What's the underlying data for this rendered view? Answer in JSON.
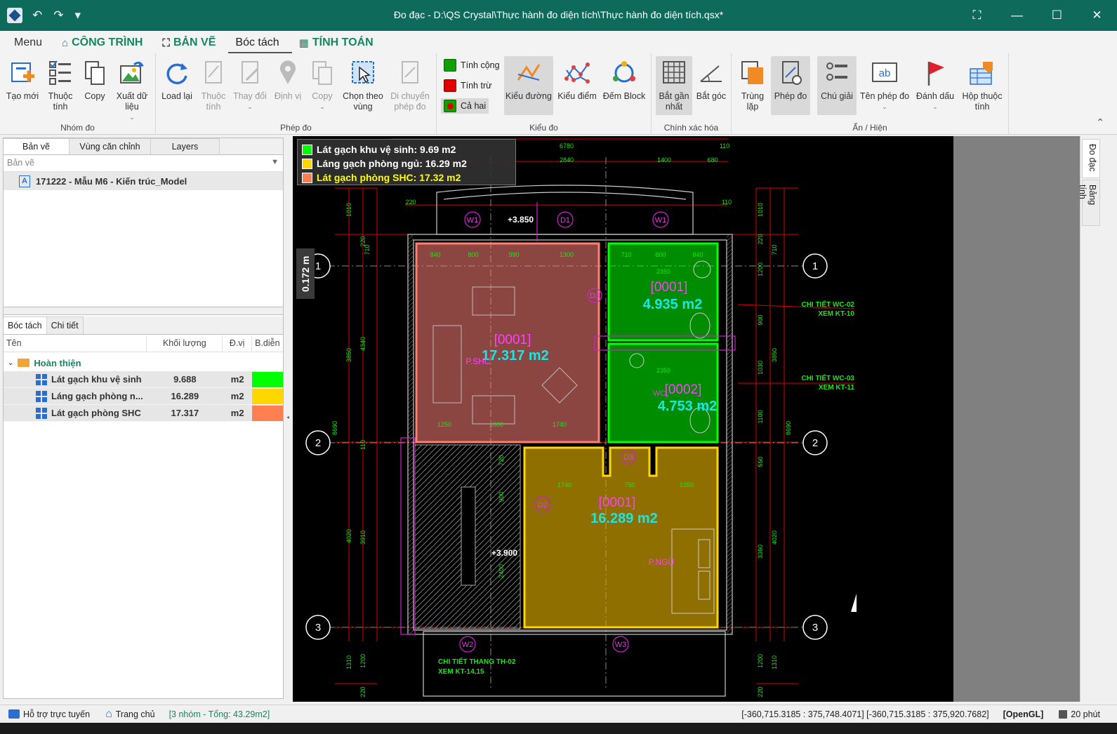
{
  "window": {
    "title": "Đo đạc - D:\\QS Crystal\\Thực hành đo diện tích\\Thực hành đo diện tích.qsx*",
    "quick_access": {
      "undo": "↶",
      "redo": "↷",
      "more": "▾"
    },
    "controls": {
      "restore": "⛶",
      "minimize": "—",
      "maximize": "☐",
      "close": "✕"
    }
  },
  "tabs": {
    "menu": "Menu",
    "cong_trinh": "CÔNG TRÌNH",
    "ban_ve": "BẢN VẼ",
    "boc_tach": "Bóc tách",
    "tinh_toan": "TÍNH TOÁN"
  },
  "ribbon": {
    "nhom_do": {
      "label": "Nhóm đo",
      "tao_moi": "Tạo mới",
      "thuoc_tinh": "Thuộc\ntính",
      "copy": "Copy",
      "xuat_du_lieu": "Xuất dữ\nliệu"
    },
    "phep_do": {
      "label": "Phép đo",
      "load_lai": "Load lại",
      "thuoc_tinh": "Thuộc\ntính",
      "thay_doi": "Thay đổi",
      "dinh_vi": "Định vị",
      "copy": "Copy",
      "chon_theo_vung": "Chọn theo\nvùng",
      "di_chuyen": "Di chuyển\nphép đo"
    },
    "kieu_do": {
      "label": "Kiểu đo",
      "tinh_cong": "Tính cộng",
      "tinh_tru": "Tính trừ",
      "ca_hai": "Cả hai",
      "kieu_duong": "Kiểu đường",
      "kieu_diem": "Kiểu điểm",
      "dem_block": "Đếm Block"
    },
    "chinh_xac_hoa": {
      "label": "Chính xác hóa",
      "bat_gan_nhat": "Bắt gần\nnhất",
      "bat_goc": "Bắt góc"
    },
    "an_hien": {
      "label": "Ẩn / Hiện",
      "trung_lap": "Trùng\nlặp",
      "phep_do": "Phép đo",
      "chu_giai": "Chú giải",
      "ten_phep_do": "Tên phép đo",
      "danh_dau": "Đánh dấu",
      "hop_thuoc_tinh": "Hộp thuộc\ntính"
    }
  },
  "left_panel": {
    "tabs": [
      "Bản vẽ",
      "Vùng căn chỉnh",
      "Layers"
    ],
    "filter_placeholder": "Bản vẽ",
    "drawing": "171222 - Mẫu M6 - Kiến trúc_Model",
    "drawing_icon": "A",
    "bottom_tabs": [
      "Bóc tách",
      "Chi tiết"
    ],
    "columns": [
      "Tên",
      "Khối lượng",
      "Đ.vị",
      "B.diễn"
    ],
    "group": "Hoàn thiện",
    "items": [
      {
        "name": "Lát gạch khu vệ sinh",
        "qty": "9.688",
        "unit": "m2",
        "color": "#00ff00"
      },
      {
        "name": "Láng gạch phòng n...",
        "qty": "16.289",
        "unit": "m2",
        "color": "#ffd700"
      },
      {
        "name": "Lát gạch phòng SHC",
        "qty": "17.317",
        "unit": "m2",
        "color": "#ff7f50"
      }
    ]
  },
  "canvas": {
    "legend": [
      {
        "text": "Lát gạch khu vệ sinh: 9.69 m2",
        "color": "#00ff00",
        "text_color": "#ffffff"
      },
      {
        "text": "Láng gạch phòng ngủ: 16.29 m2",
        "color": "#ffd700",
        "text_color": "#ffffff"
      },
      {
        "text": "Lát gạch phòng SHC: 17.32 m2",
        "color": "#ff7f50",
        "text_color": "#ffff00"
      }
    ],
    "scale_label": "0.172 m",
    "areas": {
      "shc_id": "[0001]",
      "shc_area": "17.317 m2",
      "shc_room": "P.SHC",
      "wc1_id": "[0001]",
      "wc1_area": "4.935 m2",
      "wc2_id": "[0002]",
      "wc2_area": "4.753 m2",
      "ngu_id": "[0001]",
      "ngu_area": "16.289 m2",
      "ngu_room": "P.NGỦ"
    },
    "dims_top": [
      "6780",
      "2840",
      "1400",
      "680",
      "110",
      "220",
      "110"
    ],
    "dims_room": [
      "840",
      "800",
      "990",
      "1300",
      "710",
      "800",
      "840",
      "2350",
      "1250",
      "1000",
      "1740",
      "2350",
      "1740",
      "750",
      "1350"
    ],
    "dims_left": [
      "1010",
      "220",
      "710",
      "3850",
      "4340",
      "8690",
      "110",
      "720",
      "900",
      "4020",
      "3910",
      "2400",
      "1200",
      "1310",
      "220"
    ],
    "dims_right": [
      "1010",
      "220",
      "710",
      "1200",
      "900",
      "1030",
      "3850",
      "1100",
      "8690",
      "550",
      "4020",
      "3360",
      "1200",
      "1310",
      "220"
    ],
    "grid": [
      "1",
      "2",
      "3"
    ],
    "levels": [
      "+3.850",
      "+3.900"
    ],
    "tags": [
      "W1",
      "D1",
      "W1",
      "D3",
      "D3",
      "D2",
      "W2",
      "W3",
      "WC"
    ],
    "notes": [
      "CHI TIẾT WC-02",
      "XEM KT-10",
      "CHI TIẾT WC-03",
      "XEM KT-11",
      "CHI TIẾT THANG TH-02",
      "XEM KT-14,15"
    ]
  },
  "side_tabs": [
    "Đo đạc",
    "Bảng tính"
  ],
  "status": {
    "support": "Hỗ trợ trực tuyến",
    "home": "Trang chủ",
    "summary": "[3 nhóm - Tổng: 43.29m2]",
    "coords": "[-360,715.3185 : 375,748.4071] [-360,715.3185 : 375,920.7682]",
    "renderer": "[OpenGL]",
    "autosave": "20 phút"
  },
  "colors": {
    "titlebar": "#0e6b5c",
    "accent_green": "#17865f",
    "wc": "#00ff00",
    "ngu": "#ffd700",
    "shc": "#ff7f50"
  }
}
